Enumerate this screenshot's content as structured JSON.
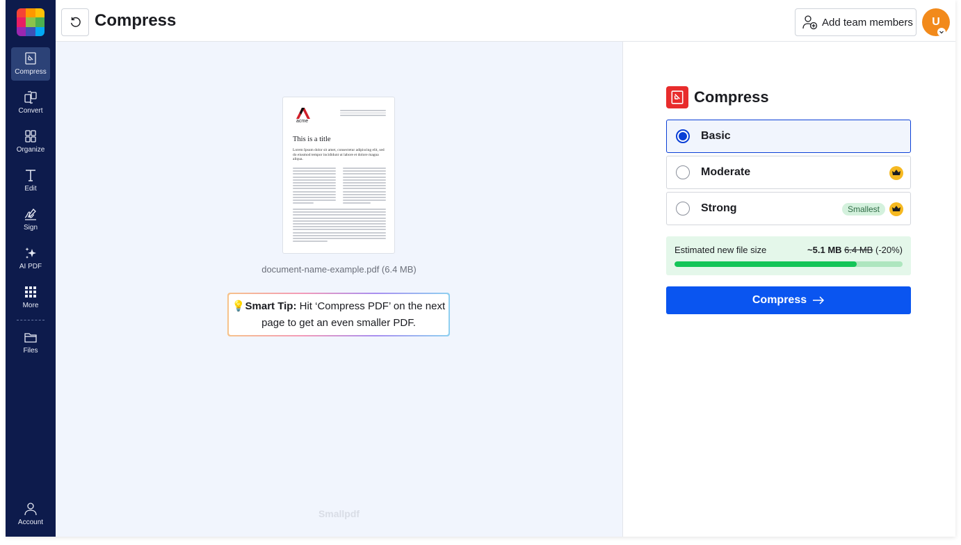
{
  "app": {
    "title": "Compress"
  },
  "sidebar": {
    "items": [
      {
        "label": "Compress",
        "icon": "compress-icon",
        "active": true
      },
      {
        "label": "Convert",
        "icon": "convert-icon"
      },
      {
        "label": "Organize",
        "icon": "organize-icon"
      },
      {
        "label": "Edit",
        "icon": "edit-text-icon"
      },
      {
        "label": "Sign",
        "icon": "sign-icon"
      },
      {
        "label": "AI PDF",
        "icon": "sparkle-icon"
      },
      {
        "label": "More",
        "icon": "grid-icon"
      },
      {
        "label": "Files",
        "icon": "folder-icon"
      },
      {
        "label": "Account",
        "icon": "user-icon"
      }
    ]
  },
  "header": {
    "title": "Compress",
    "team_button": "Add team members",
    "avatar_initial": "U"
  },
  "preview": {
    "doc_logo_text": "acme",
    "doc_title": "This is a title",
    "doc_intro": "Lorem Ipsum dolor sit amet, consectetur adipiscing elit, sed do eiusmod tempor incididunt ut labore et dolore magna aliqua.",
    "file_name": "document-name-example.pdf (6.4 MB)",
    "tip_label": "Smart Tip:",
    "tip_text_1": "Hit ‘Compress PDF’ on the next",
    "tip_text_2": "page to get an even smaller PDF.",
    "watermark": "Smallpdf"
  },
  "panel": {
    "title": "Compress",
    "options": [
      {
        "label": "Basic",
        "selected": true
      },
      {
        "label": "Moderate",
        "premium": true
      },
      {
        "label": "Strong",
        "premium": true,
        "badge": "Smallest"
      }
    ],
    "estimate": {
      "label": "Estimated new file size",
      "new_size": "~5.1 MB",
      "old_size": "6.4 MB",
      "reduction": "(-20%)",
      "progress": 0.8
    },
    "button": "Compress"
  },
  "colors": {
    "sidebar_bg": "#0d1b4c",
    "primary": "#0a55f0",
    "accent_red": "#e82c2c",
    "progress_green": "#14c558",
    "crown_yellow": "#f6b921",
    "avatar_orange": "#f28a1b"
  }
}
